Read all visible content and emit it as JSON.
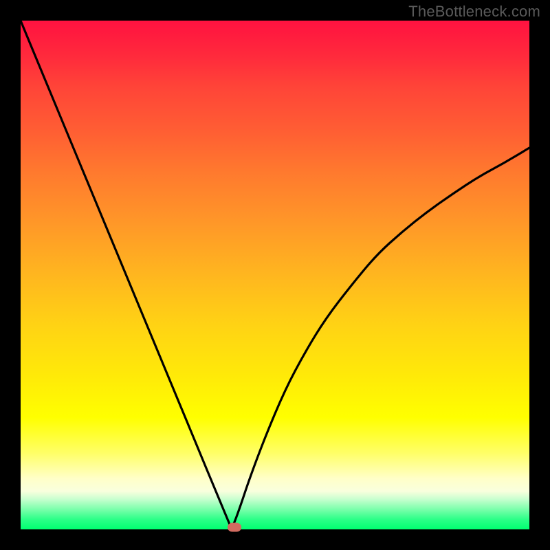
{
  "watermark": "TheBottleneck.com",
  "chart_data": {
    "type": "line",
    "title": "",
    "xlabel": "",
    "ylabel": "",
    "xlim": [
      0,
      1
    ],
    "ylim": [
      0,
      1
    ],
    "grid": false,
    "legend": false,
    "background_gradient": {
      "top_color": "#ff1240",
      "bottom_color": "#00ff71",
      "description": "vertical gradient from red (top) through orange/yellow to green (bottom)"
    },
    "series": [
      {
        "name": "curve",
        "description": "V-shaped dip curve; steep linear descent on the left, minimum near x≈0.415, curved rise on the right approaching ~0.75 at x=1",
        "x": [
          0.0,
          0.05,
          0.1,
          0.15,
          0.2,
          0.25,
          0.3,
          0.35,
          0.38,
          0.4,
          0.41,
          0.415,
          0.43,
          0.45,
          0.48,
          0.52,
          0.56,
          0.6,
          0.65,
          0.7,
          0.75,
          0.8,
          0.85,
          0.9,
          0.95,
          1.0
        ],
        "y": [
          1.0,
          0.879,
          0.759,
          0.638,
          0.518,
          0.397,
          0.277,
          0.156,
          0.084,
          0.036,
          0.012,
          0.0,
          0.04,
          0.1,
          0.18,
          0.275,
          0.35,
          0.415,
          0.48,
          0.54,
          0.585,
          0.625,
          0.66,
          0.693,
          0.72,
          0.75
        ]
      }
    ],
    "marker": {
      "name": "highlight-marker",
      "x": 0.42,
      "y": 0.0,
      "color": "#d26b60",
      "shape": "rounded-rect"
    }
  }
}
